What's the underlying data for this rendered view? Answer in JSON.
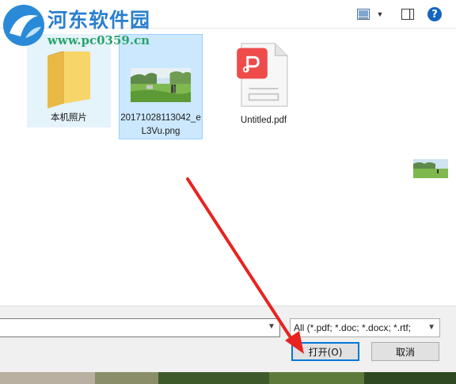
{
  "toolbar": {
    "view_icon": "view-icon",
    "view_dropdown_icon": "chevron-down-icon",
    "preview_icon": "preview-pane-icon",
    "help_label": "?"
  },
  "watermark": {
    "title": "河东软件园",
    "url": "www.pc0359.cn"
  },
  "files": [
    {
      "name": "本机照片",
      "type": "folder"
    },
    {
      "name": "20171028113042_eL3Vu.png",
      "type": "png",
      "selected": true
    },
    {
      "name": "Untitled.pdf",
      "type": "pdf"
    }
  ],
  "bottom": {
    "filename_value": "",
    "filetype_label": "All (*.pdf; *.doc; *.docx; *.rtf;",
    "open_label": "打开(O)",
    "cancel_label": "取消"
  },
  "colors": {
    "accent": "#0078d7",
    "selection": "#cce8ff",
    "arrow": "#e8231f"
  }
}
